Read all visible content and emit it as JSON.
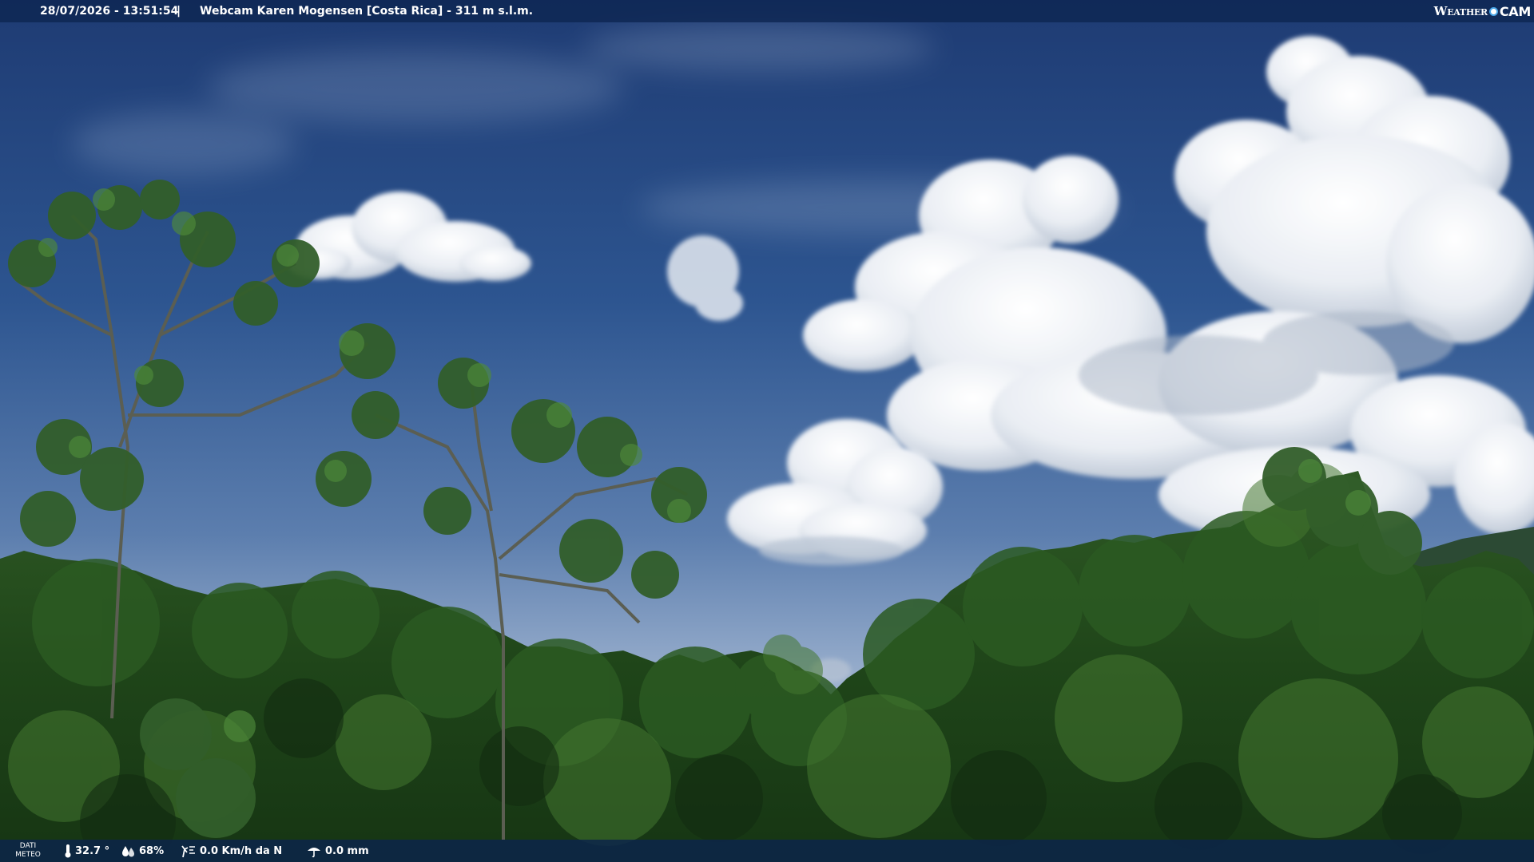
{
  "header": {
    "timestamp": "28/07/2026 - 13:51:54",
    "separator": "|",
    "title": "Webcam Karen Mogensen [Costa Rica] - 311 m s.l.m.",
    "logo_part1": "Weather",
    "logo_part2": "CAM"
  },
  "weather": {
    "label_line1": "DATI",
    "label_line2": "METEO",
    "temperature": "32.7 °",
    "humidity": "68%",
    "wind": "0.0 Km/h da N",
    "rain": "0.0 mm"
  },
  "icons": [
    "thermometer-icon",
    "humidity-icon",
    "wind-icon",
    "rain-icon",
    "weathercam-logo"
  ],
  "colors": {
    "bar_bg": "#0e2652",
    "sky_top": "#1f3f78",
    "sky_bottom": "#8fa8c8",
    "foliage_dark": "#163c16",
    "foliage_light": "#3d6e2a",
    "cloud": "#f2f4f7"
  }
}
